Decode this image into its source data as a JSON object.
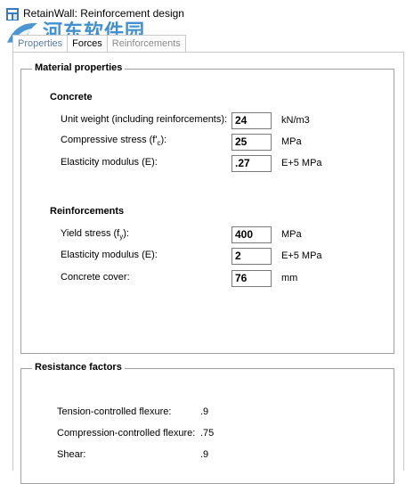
{
  "window": {
    "title": "RetainWall: Reinforcement design"
  },
  "watermark": {
    "logo_text": "河东软件园",
    "url": "www.pc0359.cn"
  },
  "tabs": [
    {
      "label": "Properties"
    },
    {
      "label": "Forces"
    },
    {
      "label": "Reinforcements"
    }
  ],
  "material": {
    "title": "Material properties",
    "concrete": {
      "title": "Concrete",
      "unit_weight": {
        "label": "Unit weight (including reinforcements):",
        "value": "24",
        "unit": "kN/m3"
      },
      "compressive": {
        "label_pre": "Compressive stress (f'",
        "label_sub": "c",
        "label_post": "):",
        "value": "25",
        "unit": "MPa"
      },
      "elasticity": {
        "label": "Elasticity modulus (E):",
        "value": ".27",
        "unit": "E+5 MPa"
      }
    },
    "reinforcements": {
      "title": "Reinforcements",
      "yield": {
        "label_pre": "Yield stress (f",
        "label_sub": "y",
        "label_post": "):",
        "value": "400",
        "unit": "MPa"
      },
      "elasticity": {
        "label": "Elasticity modulus (E):",
        "value": "2",
        "unit": "E+5 MPa"
      },
      "cover": {
        "label": "Concrete cover:",
        "value": "76",
        "unit": "mm"
      }
    }
  },
  "resistance": {
    "title": "Resistance factors",
    "tension": {
      "label": "Tension-controlled flexure:",
      "value": ".9"
    },
    "compression": {
      "label": "Compression-controlled flexure:",
      "value": ".75"
    },
    "shear": {
      "label": "Shear:",
      "value": ".9"
    }
  }
}
